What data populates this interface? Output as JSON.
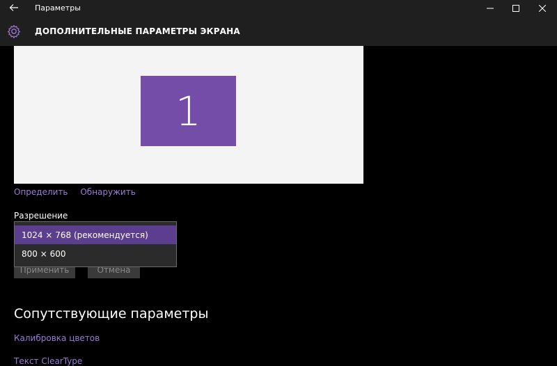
{
  "titlebar": {
    "app_title": "Параметры",
    "back_icon": "arrow-left-icon",
    "minimize_glyph": "—",
    "maximize_glyph": "☐",
    "close_glyph": "✕"
  },
  "header": {
    "title": "ДОПОЛНИТЕЛЬНЫЕ ПАРАМЕТРЫ ЭКРАНА",
    "icon": "gear-icon"
  },
  "display": {
    "monitor_number": "1",
    "tile_color": "#744da9"
  },
  "links": {
    "identify": "Определить",
    "detect": "Обнаружить"
  },
  "resolution": {
    "label": "Разрешение",
    "options": [
      "1024 × 768 (рекомендуется)",
      "800 × 600"
    ],
    "selected_index": 0
  },
  "actions": {
    "apply": "Применить",
    "cancel": "Отмена"
  },
  "related": {
    "title": "Сопутствующие параметры",
    "items": [
      "Калибровка цветов",
      "Текст ClearType"
    ]
  },
  "colors": {
    "accent": "#744da9",
    "link": "#9e7ad8",
    "background": "#000000",
    "chrome": "#1f1f1f"
  }
}
